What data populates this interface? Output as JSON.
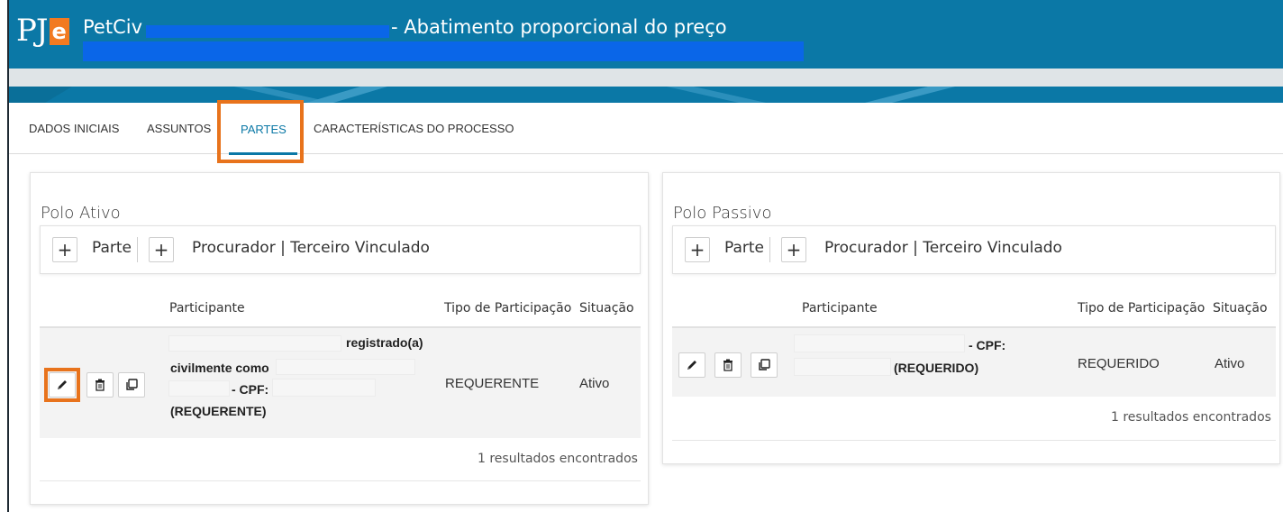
{
  "header": {
    "logo_text": "PJ",
    "logo_badge": "e",
    "title_prefix": "PetCiv",
    "title_rest": "- Abatimento proporcional do preço"
  },
  "tabs": [
    {
      "label": "DADOS INICIAIS",
      "active": false
    },
    {
      "label": "ASSUNTOS",
      "active": false
    },
    {
      "label": "PARTES",
      "active": true
    },
    {
      "label": "CARACTERÍSTICAS DO PROCESSO",
      "active": false
    }
  ],
  "polo_ativo": {
    "title": "Polo Ativo",
    "add_parte": "Parte",
    "add_procurador": "Procurador | Terceiro Vinculado",
    "columns": [
      "Participante",
      "Tipo de Participação",
      "Situação"
    ],
    "row": {
      "line1": "registrado(a)",
      "line2": "civilmente como",
      "line3": "- CPF:",
      "line4": "(REQUERENTE)",
      "tipo": "REQUERENTE",
      "situacao": "Ativo"
    },
    "results": "1 resultados encontrados"
  },
  "polo_passivo": {
    "title": "Polo Passivo",
    "add_parte": "Parte",
    "add_procurador": "Procurador | Terceiro Vinculado",
    "columns": [
      "Participante",
      "Tipo de Participação",
      "Situação"
    ],
    "row": {
      "line1": "- CPF:",
      "line2": "(REQUERIDO)",
      "tipo": "REQUERIDO",
      "situacao": "Ativo"
    },
    "results": "1 resultados encontrados"
  },
  "colors": {
    "header_blue": "#0b78a6",
    "highlight_orange": "#e8731c",
    "redaction_blue": "#0a66e8"
  },
  "icons": [
    "pencil-icon",
    "trash-icon",
    "copy-icon",
    "plus-icon"
  ]
}
